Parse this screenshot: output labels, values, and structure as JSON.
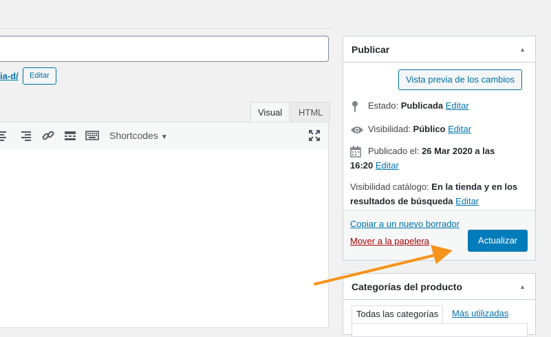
{
  "editor": {
    "permalink_tail": "ia-d/",
    "edit_slug_label": "Editar",
    "tabs": {
      "visual": "Visual",
      "html": "HTML"
    },
    "toolbar": {
      "shortcodes_label": "Shortcodes"
    }
  },
  "publish_box": {
    "title": "Publicar",
    "preview_button": "Vista previa de los cambios",
    "status": {
      "label": "Estado:",
      "value": "Publicada",
      "edit": "Editar"
    },
    "visibility": {
      "label": "Visibilidad:",
      "value": "Público",
      "edit": "Editar"
    },
    "published": {
      "label": "Publicado el:",
      "value_line1": "26 Mar 2020 a las",
      "value_line2": "16:20",
      "edit": "Editar"
    },
    "catalog_visibility": {
      "label": "Visibilidad catálogo:",
      "value_line1": "En la tienda y en los",
      "value_line2": "resultados de búsqueda",
      "edit": "Editar"
    },
    "copy_link": "Copiar a un nuevo borrador",
    "trash_link": "Mover a la papelera",
    "update_button": "Actualizar"
  },
  "categories_box": {
    "title": "Categorías del producto",
    "tab_all": "Todas las categorías",
    "tab_most_used": "Más utilizadas"
  },
  "colors": {
    "primary": "#007cba",
    "link": "#0073aa",
    "trash": "#a00",
    "annotation_arrow": "#f7941d"
  }
}
